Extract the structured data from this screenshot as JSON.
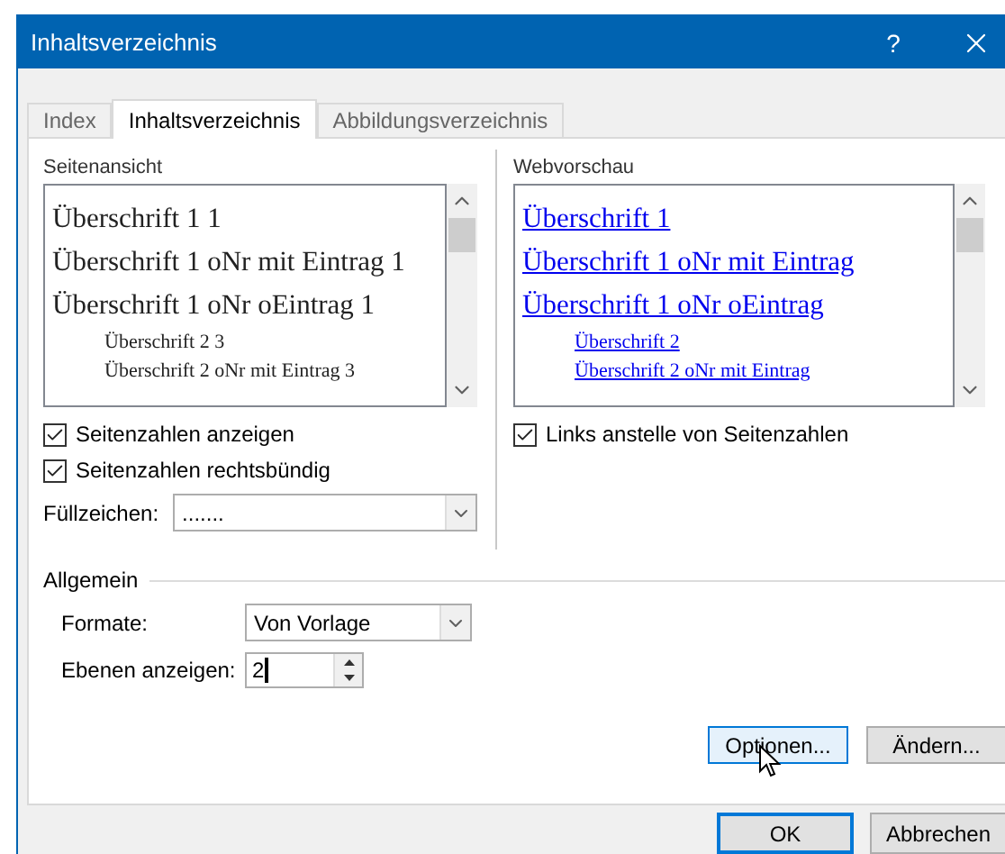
{
  "window": {
    "title": "Inhaltsverzeichnis",
    "help": "?"
  },
  "tabs": [
    {
      "label": "Index",
      "selected": false
    },
    {
      "label": "Inhaltsverzeichnis",
      "selected": true
    },
    {
      "label": "Abbildungsverzeichnis",
      "selected": false
    }
  ],
  "print_preview": {
    "label": "Seitenansicht",
    "entries": [
      {
        "text": "Überschrift 1 1"
      },
      {
        "text": "Überschrift 1 oNr mit Eintrag 1"
      },
      {
        "text": "Überschrift 1 oNr oEintrag 1",
        "children": [
          {
            "text": "Überschrift 2 3"
          },
          {
            "text": "Überschrift 2 oNr mit Eintrag 3"
          }
        ]
      }
    ]
  },
  "print_options": [
    {
      "label": "Seitenzahlen anzeigen",
      "checked": true
    },
    {
      "label": "Seitenzahlen rechtsbündig",
      "checked": true
    }
  ],
  "fill_char": {
    "label": "Füllzeichen:",
    "value": "......."
  },
  "web_preview": {
    "label": "Webvorschau",
    "entries": [
      {
        "text": "Überschrift 1"
      },
      {
        "text": "Überschrift 1 oNr mit Eintrag"
      },
      {
        "text": "Überschrift 1 oNr oEintrag",
        "children": [
          {
            "text": "Überschrift 2"
          },
          {
            "text": "Überschrift 2 oNr mit Eintrag"
          }
        ]
      }
    ]
  },
  "web_options": [
    {
      "label": "Links anstelle von Seitenzahlen",
      "checked": true
    }
  ],
  "general": {
    "title": "Allgemein",
    "formats": {
      "label": "Formate:",
      "value": "Von Vorlage"
    },
    "levels": {
      "label": "Ebenen anzeigen:",
      "value": "2"
    }
  },
  "panel_buttons": [
    {
      "label": "Optionen...",
      "hovered": true
    },
    {
      "label": "Ändern...",
      "hovered": false
    }
  ],
  "footer_buttons": [
    {
      "label": "OK",
      "default": true
    },
    {
      "label": "Abbrechen",
      "default": false
    }
  ]
}
